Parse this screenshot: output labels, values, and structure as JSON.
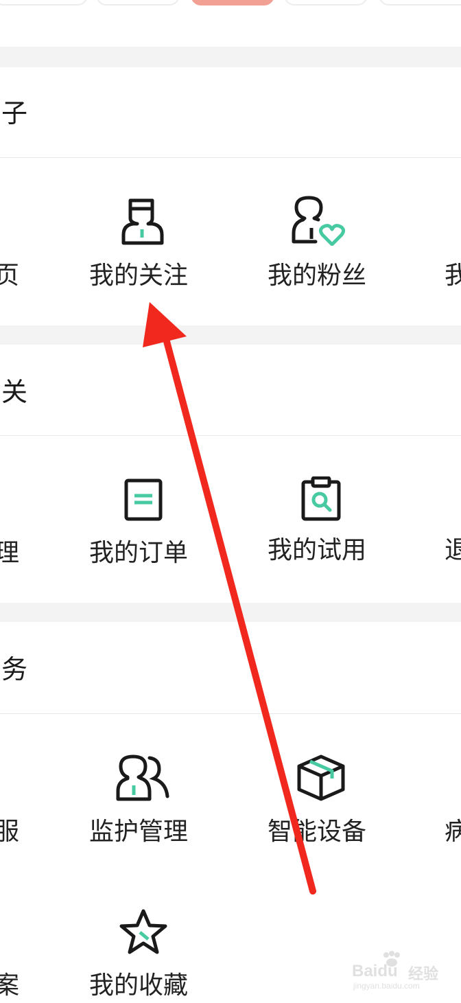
{
  "colors": {
    "accent_teal": "#47c9a2",
    "active_tab": "#f3a094",
    "arrow_red": "#f0281e",
    "icon_stroke": "#1a1a1a"
  },
  "sections": [
    {
      "title": "子",
      "items": [
        {
          "label": "页",
          "icon": ""
        },
        {
          "label": "我的关注",
          "icon": "following-person-icon"
        },
        {
          "label": "我的粉丝",
          "icon": "fans-person-heart-icon"
        },
        {
          "label": "我",
          "icon": ""
        }
      ]
    },
    {
      "title": "关",
      "items": [
        {
          "label": "理",
          "icon": ""
        },
        {
          "label": "我的订单",
          "icon": "order-document-icon"
        },
        {
          "label": "我的试用",
          "icon": "trial-clipboard-search-icon"
        },
        {
          "label": "退",
          "icon": ""
        }
      ]
    },
    {
      "title": "务",
      "items": [
        {
          "label": "服",
          "icon": ""
        },
        {
          "label": "监护管理",
          "icon": "guardian-people-icon"
        },
        {
          "label": "智能设备",
          "icon": "smart-device-box-icon"
        },
        {
          "label": "病",
          "icon": ""
        },
        {
          "label": "案",
          "icon": ""
        },
        {
          "label": "我的收藏",
          "icon": "favorites-star-icon"
        }
      ]
    }
  ],
  "watermark": {
    "brand": "Baidu",
    "cn": "经验",
    "url": "jingyan.baidu.com"
  }
}
